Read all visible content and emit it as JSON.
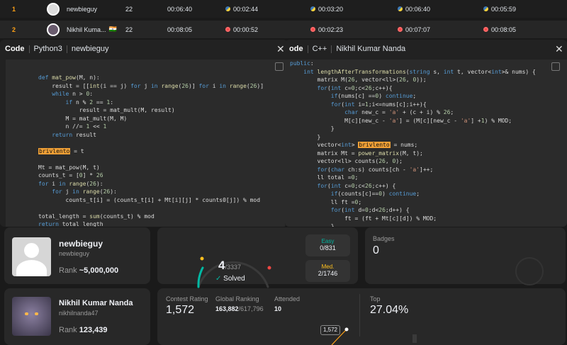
{
  "rows": [
    {
      "rank": "1",
      "name": "newbieguy",
      "score": "22",
      "finish": "00:06:40",
      "q1": "00:02:44",
      "q2": "00:03:20",
      "q3": "00:06:40",
      "q4": "00:05:59",
      "lang": "py"
    },
    {
      "rank": "2",
      "name": "Nikhil Kuma...",
      "flag": "🇮🇳",
      "score": "22",
      "finish": "00:08:05",
      "q1": "00:00:52",
      "q2": "00:02:23",
      "q3": "00:07:07",
      "q4": "00:08:05",
      "lang": "cpp"
    }
  ],
  "code_left": {
    "title": "Code",
    "lang": "Python3",
    "user": "newbieguy"
  },
  "code_right": {
    "title": "ode",
    "lang": "C++",
    "user": "Nikhil Kumar Nanda"
  },
  "profile1": {
    "name": "newbieguy",
    "handle": "newbieguy",
    "rank_label": "Rank",
    "rank": "~5,000,000"
  },
  "solved": {
    "count": "4",
    "total": "/3337",
    "label": "Solved",
    "easy_label": "Easy",
    "easy": "0/831",
    "med_label": "Med.",
    "med": "2/1746"
  },
  "badges": {
    "label": "Badges",
    "count": "0"
  },
  "profile2": {
    "name": "Nikhil Kumar Nanda",
    "handle": "nikhilnanda47",
    "rank_label": "Rank",
    "rank": "123,439"
  },
  "contest": {
    "rating_label": "Contest Rating",
    "rating": "1,572",
    "global_label": "Global Ranking",
    "global": "163,882",
    "global_total": "/617,796",
    "attended_label": "Attended",
    "attended": "10",
    "top_label": "Top",
    "top": "27.04%",
    "tooltip": "1,572"
  },
  "colors": {
    "accent": "#ffa116",
    "easy": "#00b8a3",
    "med": "#ffc01e",
    "hard": "#ef4743"
  }
}
